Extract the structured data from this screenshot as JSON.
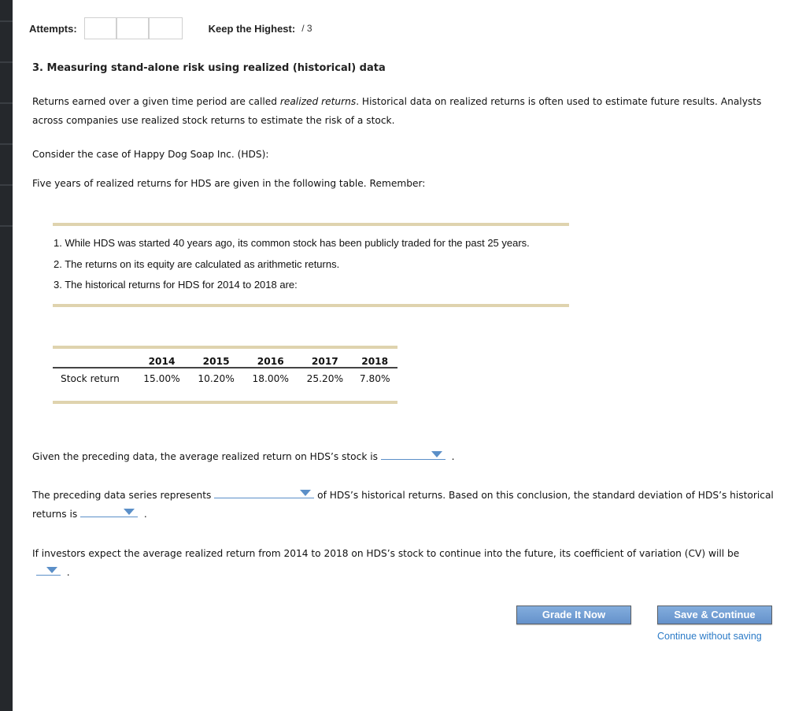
{
  "header": {
    "attempts_label": "Attempts:",
    "attempt_boxes": [
      "",
      "",
      ""
    ],
    "keep_label": "Keep the Highest:",
    "keep_value": "/ 3"
  },
  "question": {
    "title": "3. Measuring stand-alone risk using realized (historical) data",
    "intro_part1": "Returns earned over a given time period are called ",
    "intro_italic": "realized returns",
    "intro_part2": ". Historical data on realized returns is often used to estimate future results. Analysts across companies use realized stock returns to estimate the risk of a stock.",
    "consider": "Consider the case of Happy Dog Soap Inc. (HDS):",
    "five_years": "Five years of realized returns for HDS are given in the following table. Remember:",
    "notes": [
      "1.  While HDS was started 40 years ago, its common stock has been publicly traded for the past 25 years.",
      "2.  The returns on its equity are calculated as arithmetic returns.",
      "3.  The historical returns for HDS for 2014 to 2018 are:"
    ]
  },
  "table": {
    "years": [
      "2014",
      "2015",
      "2016",
      "2017",
      "2018"
    ],
    "row_label": "Stock return",
    "values": [
      "15.00%",
      "10.20%",
      "18.00%",
      "25.20%",
      "7.80%"
    ]
  },
  "prompts": {
    "avg_before": "Given the preceding data, the average realized return on HDS’s stock is",
    "avg_after": ".",
    "series_before": "The preceding data series represents",
    "series_after": "of HDS’s historical returns. Based on this conclusion, the standard deviation of HDS’s historical",
    "returns_is": "returns is",
    "returns_after": ".",
    "cv_text": "If investors expect the average realized return from 2014 to 2018 on HDS’s stock to continue into the future, its coefficient of variation (CV) will be",
    "cv_after": ".",
    "dropdown_values": {
      "average_return": "",
      "series_represents": "",
      "std_dev": "",
      "cv": ""
    }
  },
  "actions": {
    "grade_label": "Grade It Now",
    "save_label": "Save & Continue",
    "continue_link": "Continue without saving"
  },
  "colors": {
    "sidebar": "#25282c",
    "accent_rule": "#dfd3ae",
    "dropdown_blue": "#5b8fc8",
    "button_blue": "#6f9bd2",
    "link_blue": "#2c7bc7"
  }
}
